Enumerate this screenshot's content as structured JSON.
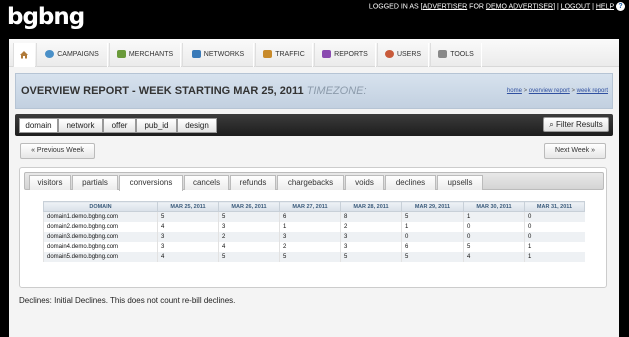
{
  "app": {
    "logo": "bgbng"
  },
  "header": {
    "logged_prefix": "LOGGED IN AS [",
    "user": "ADVERTISER",
    "for_text": " FOR ",
    "account": "DEMO ADVERTISER",
    "sep": "] | ",
    "logout": "LOGOUT",
    "sep2": " | ",
    "help": "HELP"
  },
  "nav": {
    "items": [
      {
        "label": "CAMPAIGNS",
        "icon": "campaigns-icon",
        "color": "#4a90c8"
      },
      {
        "label": "MERCHANTS",
        "icon": "merchants-icon",
        "color": "#6a9a3a"
      },
      {
        "label": "NETWORKS",
        "icon": "networks-icon",
        "color": "#3a7ab8"
      },
      {
        "label": "TRAFFIC",
        "icon": "traffic-icon",
        "color": "#c88a2a"
      },
      {
        "label": "REPORTS",
        "icon": "reports-icon",
        "color": "#8a4ab0"
      },
      {
        "label": "USERS",
        "icon": "users-icon",
        "color": "#c85a3a"
      },
      {
        "label": "TOOLS",
        "icon": "tools-icon",
        "color": "#888888"
      }
    ]
  },
  "page": {
    "title": "OVERVIEW REPORT - WEEK STARTING MAR 25, 2011",
    "timezone_label": "TIMEZONE:",
    "breadcrumb": {
      "home": "home",
      "sep": " > ",
      "overview": "overview report",
      "week": "week report"
    }
  },
  "filters": {
    "tabs": [
      "domain",
      "network",
      "offer",
      "pub_id",
      "design"
    ],
    "active": "domain",
    "filter_results": "Filter Results"
  },
  "pager": {
    "previous": "« Previous Week",
    "next": "Next Week »"
  },
  "report_tabs": {
    "tabs": [
      "visitors",
      "partials",
      "conversions",
      "cancels",
      "refunds",
      "chargebacks",
      "voids",
      "declines",
      "upsells"
    ],
    "active": "conversions"
  },
  "table": {
    "headers": [
      "DOMAIN",
      "MAR 25, 2011",
      "MAR 26, 2011",
      "MAR 27, 2011",
      "MAR 28, 2011",
      "MAR 29, 2011",
      "MAR 30, 2011",
      "MAR 31, 2011"
    ],
    "rows": [
      [
        "domain1.demo.bgbng.com",
        "5",
        "5",
        "6",
        "8",
        "5",
        "1",
        "0"
      ],
      [
        "domain2.demo.bgbng.com",
        "4",
        "3",
        "1",
        "2",
        "1",
        "0",
        "0"
      ],
      [
        "domain3.demo.bgbng.com",
        "3",
        "2",
        "3",
        "3",
        "0",
        "0",
        "0"
      ],
      [
        "domain4.demo.bgbng.com",
        "3",
        "4",
        "2",
        "3",
        "6",
        "5",
        "1"
      ],
      [
        "domain5.demo.bgbng.com",
        "4",
        "5",
        "5",
        "5",
        "5",
        "4",
        "1"
      ]
    ]
  },
  "footer_note": "Declines: Initial Declines. This does not count re-bill declines."
}
